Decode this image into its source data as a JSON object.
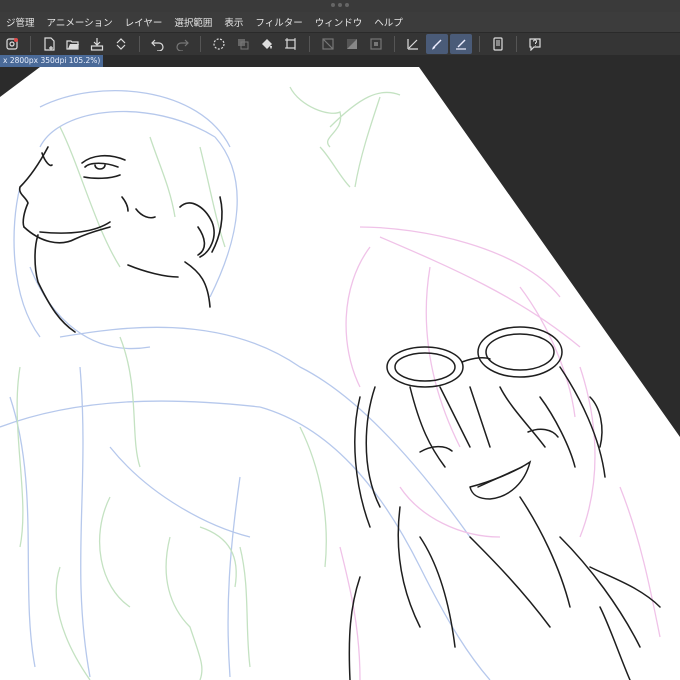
{
  "window": {
    "menus": [
      "ジ管理",
      "アニメーション",
      "レイヤー",
      "選択範囲",
      "表示",
      "フィルター",
      "ウィンドウ",
      "ヘルプ"
    ]
  },
  "toolbar": {
    "icons": [
      "settings-icon",
      "new-canvas-icon",
      "open-file-icon",
      "save-icon",
      "stepper-icon",
      "undo-icon",
      "redo-icon",
      "select-all-icon",
      "deselect-icon",
      "fill-icon",
      "transform-icon",
      "crop-icon",
      "ruler-snap-icon",
      "perspective-snap-icon",
      "pen-stabilize-icon",
      "pen-icon",
      "pen-active-icon",
      "pen-alt-icon",
      "tablet-icon",
      "help-icon"
    ]
  },
  "document": {
    "tab_label": "x 2800px 350dpi 105.2%)"
  },
  "colors": {
    "ui_bg": "#3c3c3c",
    "canvas_bg": "#2b2b2b",
    "paper": "#ffffff",
    "tab_active": "#4a6a98",
    "sketch_blue": "#b6c8ec",
    "sketch_green": "#c4e2c2",
    "sketch_pink": "#f0c2e8",
    "ink": "#1e1e1e"
  }
}
